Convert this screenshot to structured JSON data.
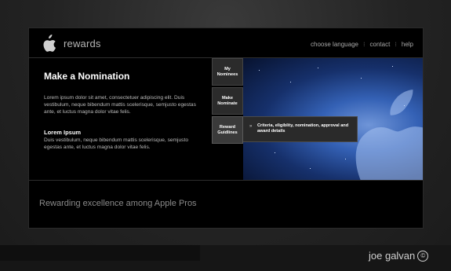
{
  "header": {
    "brand": "rewards",
    "logo_icon": "apple-logo-icon",
    "nav": [
      "choose language",
      "contact",
      "help"
    ]
  },
  "main": {
    "heading": "Make a Nomination",
    "paragraph1": "Lorem ipsum dolor sit amet, consectetuer adipiscing elit. Duis vestibulum, neque bibendum mattis scelerisque, semjusto egestas ante, et luctus magna dolor vitae felis.",
    "subheading": "Lorem Ipsum",
    "paragraph2": "Duis vestibulum, neque bibendum mattis scelerisque, semjusto egestas ante, et luctus magna dolor vitae felis."
  },
  "tabs": [
    {
      "line1": "My",
      "line2": "Nominees"
    },
    {
      "line1": "Make",
      "line2": "Nominate"
    },
    {
      "line1": "Reward",
      "line2": "Guidlines"
    }
  ],
  "callout": {
    "arrow": "»",
    "text": "Criteria, eligiblity, nomination, approval and award details"
  },
  "footer": {
    "tagline": "Rewarding excellence among Apple Pros"
  },
  "signature": {
    "text": "joe galvan",
    "symbol": "©"
  },
  "colors": {
    "frame_bg": "#000000",
    "hero_accent": "#3461b5",
    "tab_bg": "#2b2b2b"
  }
}
